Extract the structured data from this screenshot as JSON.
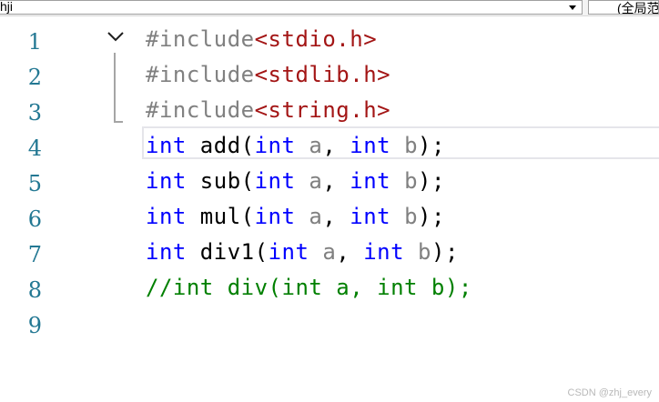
{
  "toolbar": {
    "scope_value": "hji",
    "member_value": "(全局范围)"
  },
  "editor": {
    "lines": [
      {
        "number": "1",
        "tokens": [
          [
            "pp",
            "#include"
          ],
          [
            "inc",
            "<stdio.h>"
          ]
        ]
      },
      {
        "number": "2",
        "tokens": [
          [
            "pp",
            "#include"
          ],
          [
            "inc",
            "<stdlib.h>"
          ]
        ]
      },
      {
        "number": "3",
        "tokens": [
          [
            "pp",
            "#include"
          ],
          [
            "inc",
            "<string.h>"
          ]
        ]
      },
      {
        "number": "4",
        "tokens": [
          [
            "kw",
            "int"
          ],
          [
            "txt",
            " add("
          ],
          [
            "kw",
            "int"
          ],
          [
            "txt",
            " "
          ],
          [
            "param",
            "a"
          ],
          [
            "txt",
            ", "
          ],
          [
            "kw",
            "int"
          ],
          [
            "txt",
            " "
          ],
          [
            "param",
            "b"
          ],
          [
            "txt",
            ");"
          ]
        ]
      },
      {
        "number": "5",
        "tokens": [
          [
            "kw",
            "int"
          ],
          [
            "txt",
            " sub("
          ],
          [
            "kw",
            "int"
          ],
          [
            "txt",
            " "
          ],
          [
            "param",
            "a"
          ],
          [
            "txt",
            ", "
          ],
          [
            "kw",
            "int"
          ],
          [
            "txt",
            " "
          ],
          [
            "param",
            "b"
          ],
          [
            "txt",
            ");"
          ]
        ]
      },
      {
        "number": "6",
        "tokens": [
          [
            "kw",
            "int"
          ],
          [
            "txt",
            " mul("
          ],
          [
            "kw",
            "int"
          ],
          [
            "txt",
            " "
          ],
          [
            "param",
            "a"
          ],
          [
            "txt",
            ", "
          ],
          [
            "kw",
            "int"
          ],
          [
            "txt",
            " "
          ],
          [
            "param",
            "b"
          ],
          [
            "txt",
            ");"
          ]
        ]
      },
      {
        "number": "7",
        "tokens": [
          [
            "kw",
            "int"
          ],
          [
            "txt",
            " div1("
          ],
          [
            "kw",
            "int"
          ],
          [
            "txt",
            " "
          ],
          [
            "param",
            "a"
          ],
          [
            "txt",
            ", "
          ],
          [
            "kw",
            "int"
          ],
          [
            "txt",
            " "
          ],
          [
            "param",
            "b"
          ],
          [
            "txt",
            ");"
          ]
        ]
      },
      {
        "number": "8",
        "tokens": [
          [
            "cm",
            "//int div(int a, int b);"
          ]
        ]
      },
      {
        "number": "9",
        "tokens": []
      }
    ]
  },
  "watermark": "CSDN @zhj_every"
}
